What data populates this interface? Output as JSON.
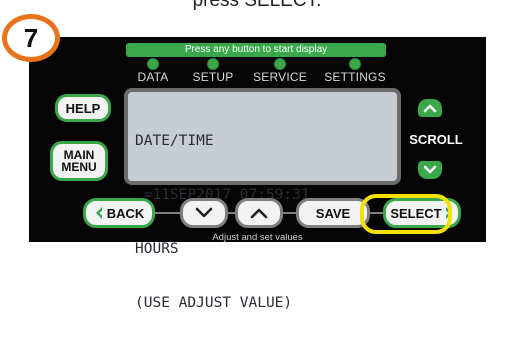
{
  "caption": "press SELECT.",
  "step_number": "7",
  "hint": "Press any button to start display",
  "tabs": [
    {
      "label": "DATA"
    },
    {
      "label": "SETUP"
    },
    {
      "label": "SERVICE"
    },
    {
      "label": "SETTINGS"
    }
  ],
  "help_label": "HELP",
  "main_menu": {
    "line1": "MAIN",
    "line2": "MENU"
  },
  "lcd_lines": [
    "DATE/TIME",
    " =11SEP2017 07:59:31",
    "HOURS",
    "(USE ADJUST VALUE)"
  ],
  "scroll_label": "SCROLL",
  "bottom_buttons": {
    "back": "BACK",
    "save": "SAVE",
    "select": "SELECT"
  },
  "footer": "Adjust and set values",
  "colors": {
    "green": "#3aa84a",
    "highlight": "#f4e100",
    "badge": "#e8731a",
    "lcd": "#c8cdd3"
  }
}
